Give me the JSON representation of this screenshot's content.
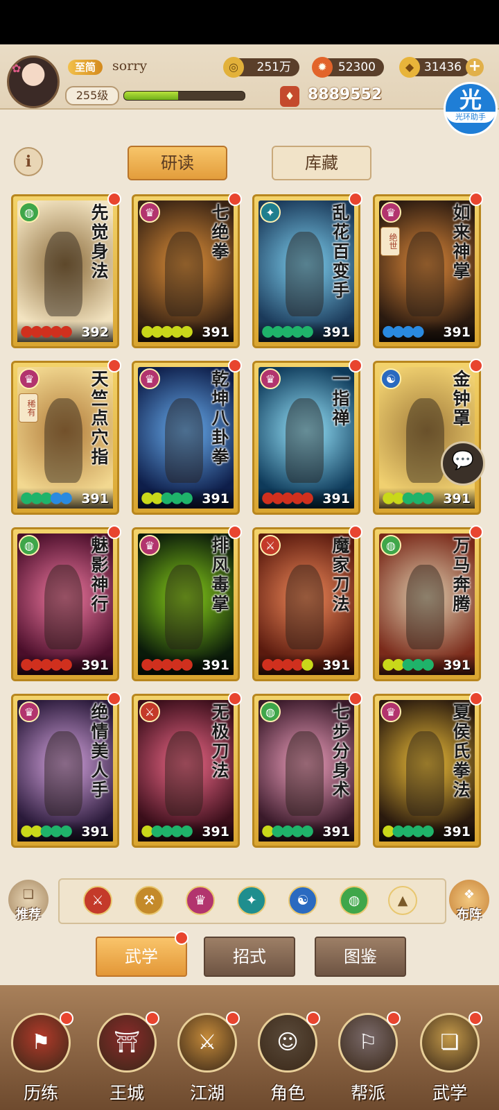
{
  "player": {
    "vip": "至简",
    "name": "sorry",
    "level": "255级",
    "exp_fraction": 0.45,
    "power": "8889552"
  },
  "resources": [
    {
      "value": "251万",
      "icon": "coin-icon"
    },
    {
      "value": "52300",
      "icon": "flame-icon"
    },
    {
      "value": "31436",
      "icon": "ingot-icon"
    }
  ],
  "helper": {
    "big": "光",
    "small": "光环助手"
  },
  "top_tabs": {
    "study": "研读",
    "storage": "库藏"
  },
  "cards": [
    {
      "title": "先觉身法",
      "value": "392",
      "drops": [
        "#d0301e",
        "#d0301e",
        "#d0301e",
        "#d0301e",
        "#d0301e"
      ],
      "emblem": "#3fa64a",
      "bg": [
        "#f2e3c0",
        "#8a6a3a"
      ],
      "tag": ""
    },
    {
      "title": "七绝拳",
      "value": "391",
      "drops": [
        "#c9d81a",
        "#c9d81a",
        "#c9d81a",
        "#c9d81a",
        "#c9d81a"
      ],
      "emblem": "#b2346e",
      "bg": [
        "#3a2414",
        "#e2923a"
      ],
      "tag": ""
    },
    {
      "title": "乱花百变手",
      "value": "391",
      "drops": [
        "#1fb36a",
        "#1fb36a",
        "#1fb36a",
        "#1fb36a",
        "#1fb36a"
      ],
      "emblem": "#1f7e8e",
      "bg": [
        "#1b3a5a",
        "#7fd2f2"
      ],
      "tag": ""
    },
    {
      "title": "如来神掌",
      "value": "391",
      "drops": [
        "#2a8ae0",
        "#2a8ae0",
        "#2a8ae0",
        "#2a8ae0"
      ],
      "emblem": "#b2346e",
      "bg": [
        "#2a1a10",
        "#e08a3a"
      ],
      "tag": "绝世"
    },
    {
      "title": "天竺点穴指",
      "value": "391",
      "drops": [
        "#1fb36a",
        "#1fb36a",
        "#1fb36a",
        "#2a8ae0",
        "#2a8ae0"
      ],
      "emblem": "#b2346e",
      "bg": [
        "#f2d890",
        "#b07a3a"
      ],
      "tag": "稀有"
    },
    {
      "title": "乾坤八卦拳",
      "value": "391",
      "drops": [
        "#c9d81a",
        "#c9d81a",
        "#1fb36a",
        "#1fb36a",
        "#1fb36a"
      ],
      "emblem": "#b2346e",
      "bg": [
        "#0e1e4a",
        "#6ab0f2"
      ],
      "tag": ""
    },
    {
      "title": "一指禅",
      "value": "391",
      "drops": [
        "#d0301e",
        "#d0301e",
        "#d0301e",
        "#d0301e",
        "#d0301e"
      ],
      "emblem": "#b2346e",
      "bg": [
        "#0e3a5a",
        "#9ae8ff"
      ],
      "tag": ""
    },
    {
      "title": "金钟罩",
      "value": "391",
      "drops": [
        "#c9d81a",
        "#c9d81a",
        "#1fb36a",
        "#1fb36a",
        "#1fb36a"
      ],
      "emblem": "#2a6ac0",
      "bg": [
        "#f0d070",
        "#a07a3a"
      ],
      "tag": ""
    },
    {
      "title": "魅影神行",
      "value": "391",
      "drops": [
        "#d0301e",
        "#d0301e",
        "#d0301e",
        "#d0301e",
        "#d0301e"
      ],
      "emblem": "#3fa64a",
      "bg": [
        "#4a0e2a",
        "#f27aa2"
      ],
      "tag": ""
    },
    {
      "title": "排风毒掌",
      "value": "391",
      "drops": [
        "#d0301e",
        "#d0301e",
        "#d0301e",
        "#d0301e",
        "#d0301e"
      ],
      "emblem": "#b2346e",
      "bg": [
        "#0a1a0a",
        "#8ad21a"
      ],
      "tag": ""
    },
    {
      "title": "魔家刀法",
      "value": "391",
      "drops": [
        "#d0301e",
        "#d0301e",
        "#d0301e",
        "#d0301e",
        "#c9d81a"
      ],
      "emblem": "#c43a2a",
      "bg": [
        "#5a1a0e",
        "#f28a5a"
      ],
      "tag": ""
    },
    {
      "title": "万马奔腾",
      "value": "391",
      "drops": [
        "#c9d81a",
        "#c9d81a",
        "#1fb36a",
        "#1fb36a",
        "#1fb36a"
      ],
      "emblem": "#3fa64a",
      "bg": [
        "#7a2a1a",
        "#e0d0b0"
      ],
      "tag": ""
    },
    {
      "title": "绝情美人手",
      "value": "391",
      "drops": [
        "#c9d81a",
        "#c9d81a",
        "#1fb36a",
        "#1fb36a",
        "#1fb36a"
      ],
      "emblem": "#b2346e",
      "bg": [
        "#2a1a3a",
        "#d8a6e2"
      ],
      "tag": ""
    },
    {
      "title": "无极刀法",
      "value": "391",
      "drops": [
        "#c9d81a",
        "#1fb36a",
        "#1fb36a",
        "#1fb36a",
        "#1fb36a"
      ],
      "emblem": "#c43a2a",
      "bg": [
        "#3a0e1a",
        "#f26a8a"
      ],
      "tag": ""
    },
    {
      "title": "七步分身术",
      "value": "391",
      "drops": [
        "#c9d81a",
        "#1fb36a",
        "#1fb36a",
        "#1fb36a",
        "#1fb36a"
      ],
      "emblem": "#3fa64a",
      "bg": [
        "#3a1a2a",
        "#f2a2c0"
      ],
      "tag": ""
    },
    {
      "title": "夏侯氏拳法",
      "value": "391",
      "drops": [
        "#c9d81a",
        "#1fb36a",
        "#1fb36a",
        "#1fb36a",
        "#1fb36a"
      ],
      "emblem": "#b2346e",
      "bg": [
        "#2a1a0e",
        "#f2c23a"
      ],
      "tag": ""
    }
  ],
  "filter": {
    "left_label": "推荐",
    "right_label": "布阵",
    "buttons": [
      {
        "icon": "sword-type-icon",
        "color": "#c43a2a"
      },
      {
        "icon": "blade-type-icon",
        "color": "#c48a2a"
      },
      {
        "icon": "palm-type-icon",
        "color": "#b2346e"
      },
      {
        "icon": "fan-type-icon",
        "color": "#1f8e8e"
      },
      {
        "icon": "taiji-type-icon",
        "color": "#2a6ac0"
      },
      {
        "icon": "swirl-type-icon",
        "color": "#3fa64a"
      },
      {
        "icon": "up-arrow-icon",
        "color": "#e8cf99"
      }
    ]
  },
  "sub_tabs": [
    "武学",
    "招式",
    "图鉴"
  ],
  "nav": [
    {
      "label": "历练",
      "color": "#b23a2a"
    },
    {
      "label": "王城",
      "color": "#8a2a2a"
    },
    {
      "label": "江湖",
      "color": "#c48a3a"
    },
    {
      "label": "角色",
      "color": "#5a4a3a"
    },
    {
      "label": "帮派",
      "color": "#7a6a6a"
    },
    {
      "label": "武学",
      "color": "#c49a4a"
    }
  ]
}
